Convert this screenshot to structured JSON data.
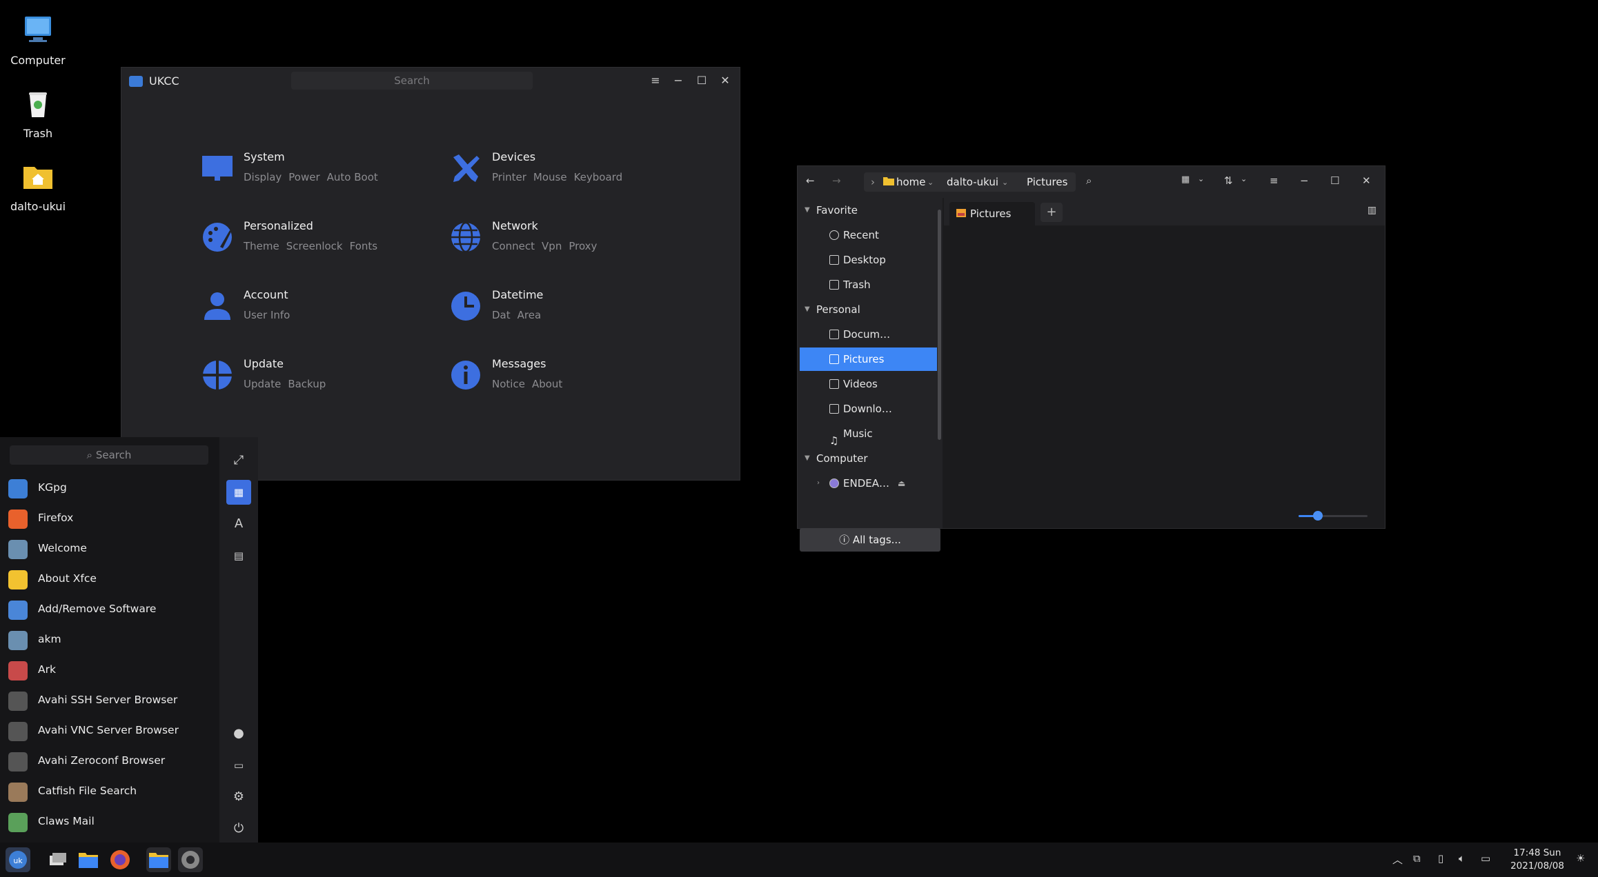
{
  "desktop": {
    "icons": [
      {
        "label": "Computer",
        "icon": "monitor-icon"
      },
      {
        "label": "Trash",
        "icon": "trash-icon"
      },
      {
        "label": "dalto-ukui",
        "icon": "home-folder-icon"
      }
    ]
  },
  "ukcc": {
    "title": "UKCC",
    "search_placeholder": "Search",
    "controls": {
      "menu": "≡",
      "minimize": "−",
      "maximize": "☐",
      "close": "✕"
    },
    "categories": [
      {
        "name": "System",
        "subs": [
          "Display",
          "Power",
          "Auto Boot"
        ],
        "icon": "monitor-icon"
      },
      {
        "name": "Devices",
        "subs": [
          "Printer",
          "Mouse",
          "Keyboard"
        ],
        "icon": "tools-icon"
      },
      {
        "name": "Personalized",
        "subs": [
          "Theme",
          "Screenlock",
          "Fonts"
        ],
        "icon": "palette-icon"
      },
      {
        "name": "Network",
        "subs": [
          "Connect",
          "Vpn",
          "Proxy"
        ],
        "icon": "globe-icon"
      },
      {
        "name": "Account",
        "subs": [
          "User Info"
        ],
        "icon": "user-icon"
      },
      {
        "name": "Datetime",
        "subs": [
          "Dat",
          "Area"
        ],
        "icon": "clock-icon"
      },
      {
        "name": "Update",
        "subs": [
          "Update",
          "Backup"
        ],
        "icon": "update-icon"
      },
      {
        "name": "Messages",
        "subs": [
          "Notice",
          "About"
        ],
        "icon": "info-icon"
      }
    ],
    "accent": "#3d6fe0"
  },
  "file_manager": {
    "breadcrumbs": [
      "home",
      "dalto-ukui",
      "Pictures"
    ],
    "sidebar": {
      "favorite": {
        "label": "Favorite",
        "items": [
          "Recent",
          "Desktop",
          "Trash"
        ]
      },
      "personal": {
        "label": "Personal",
        "items": [
          "Docum…",
          "Pictures",
          "Videos",
          "Downlo…",
          "Music"
        ]
      },
      "computer": {
        "label": "Computer",
        "items": [
          "ENDEA…"
        ]
      },
      "all_tags": "All tags..."
    },
    "selected": "Pictures",
    "tab_label": "Pictures",
    "zoom_level": 0.28,
    "accent": "#3d86f5"
  },
  "start_menu": {
    "search_placeholder": "Search",
    "apps": [
      {
        "name": "KGpg",
        "color": "#3d7fd6"
      },
      {
        "name": "Firefox",
        "color": "#e8612c"
      },
      {
        "name": "Welcome",
        "color": "#6a8fb0"
      },
      {
        "name": "About Xfce",
        "color": "#f2c230"
      },
      {
        "name": "Add/Remove Software",
        "color": "#4a86d8"
      },
      {
        "name": "akm",
        "color": "#6a8fb0"
      },
      {
        "name": "Ark",
        "color": "#c84a4a"
      },
      {
        "name": "Avahi SSH Server Browser",
        "color": "#555"
      },
      {
        "name": "Avahi VNC Server Browser",
        "color": "#555"
      },
      {
        "name": "Avahi Zeroconf Browser",
        "color": "#555"
      },
      {
        "name": "Catfish File Search",
        "color": "#9a7a5a"
      },
      {
        "name": "Claws Mail",
        "color": "#5aa05a"
      }
    ]
  },
  "taskbar": {
    "time": "17:48 Sun",
    "date": "2021/08/08"
  }
}
